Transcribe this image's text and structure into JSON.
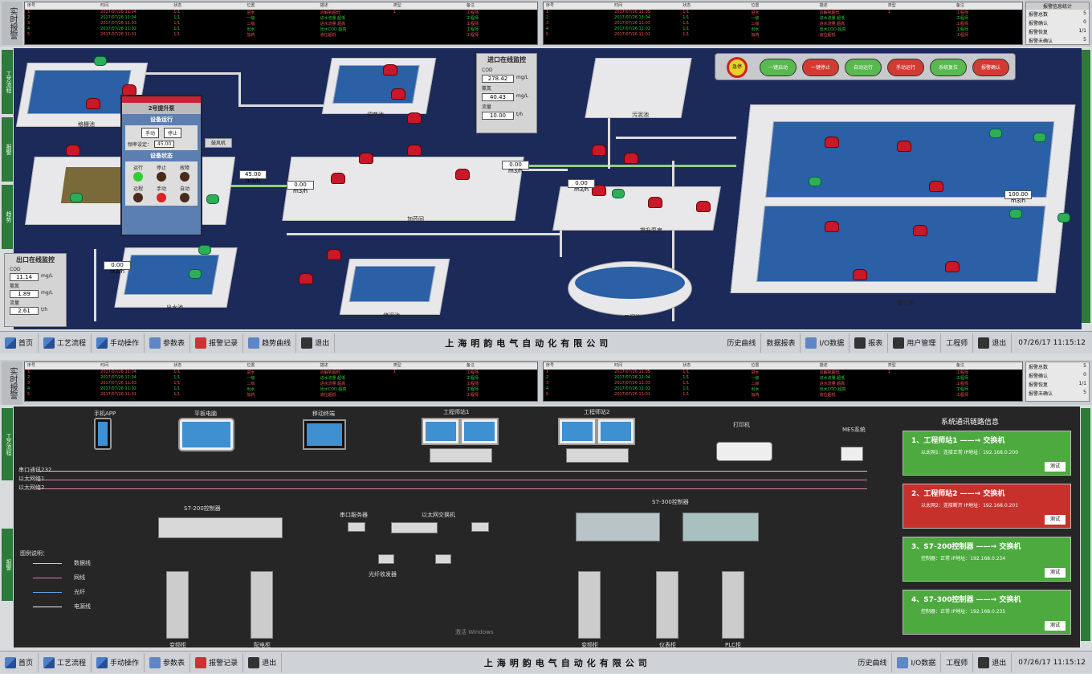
{
  "top_screen": {
    "side_title": "实时报警",
    "alarm_header": [
      "序号",
      "时间",
      "状态",
      "位置",
      "描述",
      "类型",
      "备注"
    ],
    "alarm_rows_left": [
      [
        "1",
        "2017/07/26 11:04",
        "1/1",
        "进水",
        "溶解氧超低",
        "1",
        "工程师"
      ],
      [
        "2",
        "2017/07/26 11:04",
        "1/1",
        "一级",
        "进水流量 超低",
        "",
        "工程师"
      ],
      [
        "3",
        "2017/07/26 11:03",
        "1/1",
        "二级",
        "进水流量 超高",
        "",
        "工程师"
      ],
      [
        "4",
        "2017/07/26 11:02",
        "1/1",
        "出水",
        "出水COD 超高",
        "",
        "工程师"
      ],
      [
        "5",
        "2017/07/26 11:01",
        "1/1",
        "加药",
        "液位超低",
        "",
        "工程师"
      ]
    ],
    "alarm_rows_right": [
      [
        "1",
        "2017/07/26 11:05",
        "1/1",
        "进水",
        "溶解氧超低",
        "1",
        "工程师"
      ],
      [
        "2",
        "2017/07/26 11:04",
        "1/1",
        "一级",
        "进水流量 超低",
        "",
        "工程师"
      ],
      [
        "3",
        "2017/07/26 11:03",
        "1/1",
        "二级",
        "进水流量 超高",
        "",
        "工程师"
      ],
      [
        "4",
        "2017/07/26 11:02",
        "1/1",
        "出水",
        "出水COD 超高",
        "",
        "工程师"
      ],
      [
        "5",
        "2017/07/26 11:01",
        "1/1",
        "加药",
        "液位超低",
        "",
        "工程师"
      ]
    ],
    "legend": {
      "title": "报警信息统计",
      "rows": [
        [
          "报警总数",
          "5"
        ],
        [
          "报警确认",
          "0"
        ],
        [
          "报警恢复",
          "1/1"
        ],
        [
          "报警未确认",
          "5"
        ]
      ]
    },
    "left_nav": [
      "工艺流程",
      "报警",
      "趋势"
    ],
    "process": {
      "tanks": [
        "格栅池",
        "调节池",
        "加药间",
        "曝气池",
        "沉淀池",
        "污泥池",
        "储泥池",
        "二沉池",
        "提升泵房",
        "消毒池",
        "出水池",
        "反应池"
      ],
      "inlet_panel": {
        "title": "进口在线监控",
        "labels": [
          "COD",
          "氨氮",
          "流量"
        ],
        "values": [
          "278.42",
          "40.43",
          "10.00"
        ],
        "units": [
          "mg/L",
          "mg/L",
          "t/h"
        ]
      },
      "outlet_panel": {
        "title": "出口在线监控",
        "labels": [
          "COD",
          "氨氮",
          "流量"
        ],
        "values": [
          "11.14",
          "1.89",
          "2.61"
        ],
        "units": [
          "mg/L",
          "mg/L",
          "t/h"
        ]
      },
      "popup": {
        "title": "2号提升泵",
        "sub1": "设备运行",
        "sub2": "设备状态",
        "b1": "手动",
        "b2": "停止",
        "freq_label": "频率设定：",
        "freq_value": "45.00",
        "states": [
          "运行",
          "停止",
          "故障",
          "远程",
          "手动",
          "自动"
        ]
      },
      "flows": [
        "45.00 m3/h",
        "0.00 m3/h",
        "0.00 m3/h",
        "0.00 m3/h",
        "0.00 m3/h",
        "100.00 m3/h"
      ],
      "controls": [
        "急停",
        "一键启动",
        "一键停止",
        "自动运行",
        "手动运行",
        "系统复位",
        "报警确认"
      ],
      "fan_label": "鼓风机",
      "fan_val": "0.00"
    },
    "taskbar": [
      "首页",
      "工艺流程",
      "手动操作",
      "参数表",
      "报警记录",
      "趋势曲线",
      "退出"
    ],
    "company": "上海明韵电气自动化有限公司",
    "right_items": [
      "历史曲线",
      "数据报表",
      "I/O数据",
      "报表",
      "用户管理",
      "工程师",
      "退出"
    ],
    "clock": "07/26/17 11:15:12"
  },
  "bottom_screen": {
    "side_title": "实时报警",
    "devices": [
      "手机APP",
      "平板电脑",
      "移动终端",
      "工程师站1",
      "工程师站2",
      "打印机",
      "MES系统",
      "串口服务器",
      "S7-200控制器",
      "以太网交换机",
      "光纤收发器",
      "S7-300控制器",
      "变频柜",
      "配电柜",
      "仪表柜",
      "PLC柜"
    ],
    "bus_labels": [
      "串口通讯232",
      "以太网络1",
      "以太网络2"
    ],
    "legend_title": "图例说明：",
    "legend_items": [
      "数据线",
      "网线",
      "光纤",
      "电源线"
    ],
    "status_title": "系统通讯链路信息",
    "links": [
      {
        "title": "1、工程师站1 ——→ 交换机",
        "sub": "以太网1：连接正常  IP地址：192.168.0.200",
        "button": "测试",
        "color": "#4caa3e"
      },
      {
        "title": "2、工程师站2 ——→ 交换机",
        "sub": "以太网2：连接断开  IP地址：192.168.0.201",
        "button": "测试",
        "color": "#c8302c"
      },
      {
        "title": "3、S7-200控制器 ——→ 交换机",
        "sub": "控制器：正常  IP地址：192.168.0.234",
        "button": "测试",
        "color": "#4caa3e"
      },
      {
        "title": "4、S7-300控制器 ——→ 交换机",
        "sub": "控制器：正常  IP地址：192.168.0.235",
        "button": "测试",
        "color": "#4caa3e"
      }
    ],
    "watermark": "激活 Windows",
    "clock": "07/26/17 11:15:12"
  }
}
